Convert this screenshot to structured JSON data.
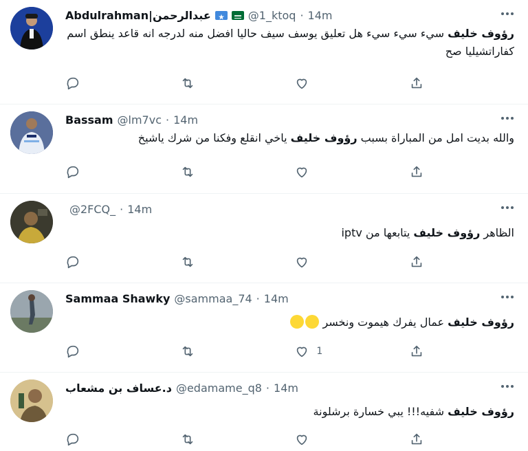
{
  "tweets": [
    {
      "name": "Abdulrahman|عبدالرحمن",
      "handle": "@1_ktoq",
      "dot": "·",
      "time": "14m",
      "bold": "رؤوف خليف",
      "text": " سيء سيء سيء هل تعليق يوسف سيف حاليا افضل منه لدرجه انه قاعد ينطق اسم كفاراتشيليا صح",
      "likes": ""
    },
    {
      "name": "Bassam",
      "handle": "@lm7vc",
      "dot": "·",
      "time": "14m",
      "pre": "والله بديت امل من المباراة بسبب ",
      "bold": "رؤوف خليف",
      "text": " ياخي انقلع وفكنا من شرك ياشيخ",
      "likes": ""
    },
    {
      "name": "",
      "handle": "@2FCQ_",
      "dot": "·",
      "time": "14m",
      "pre": "الظاهر ",
      "bold": "رؤوف خليف",
      "text": " يتابعها من iptv",
      "likes": ""
    },
    {
      "name": "Sammaa Shawky",
      "handle": "@sammaa_74",
      "dot": "·",
      "time": "14m",
      "bold": "رؤوف خليف",
      "text": " عمال يفرك هيموت ونخسر",
      "likes": "1"
    },
    {
      "name": "د.عساف بن مشعاب",
      "handle": "@edamame_q8",
      "dot": "·",
      "time": "14m",
      "bold": "رؤوف خليف",
      "text": " شفيه!!! يبي خسارة برشلونة",
      "likes": ""
    }
  ],
  "icons": {
    "reply": "reply-icon",
    "retweet": "retweet-icon",
    "like": "like-icon",
    "share": "share-icon",
    "more": "more-icon"
  },
  "colors": {
    "muted": "#536471",
    "text": "#0f1419",
    "divider": "#eff3f4"
  }
}
